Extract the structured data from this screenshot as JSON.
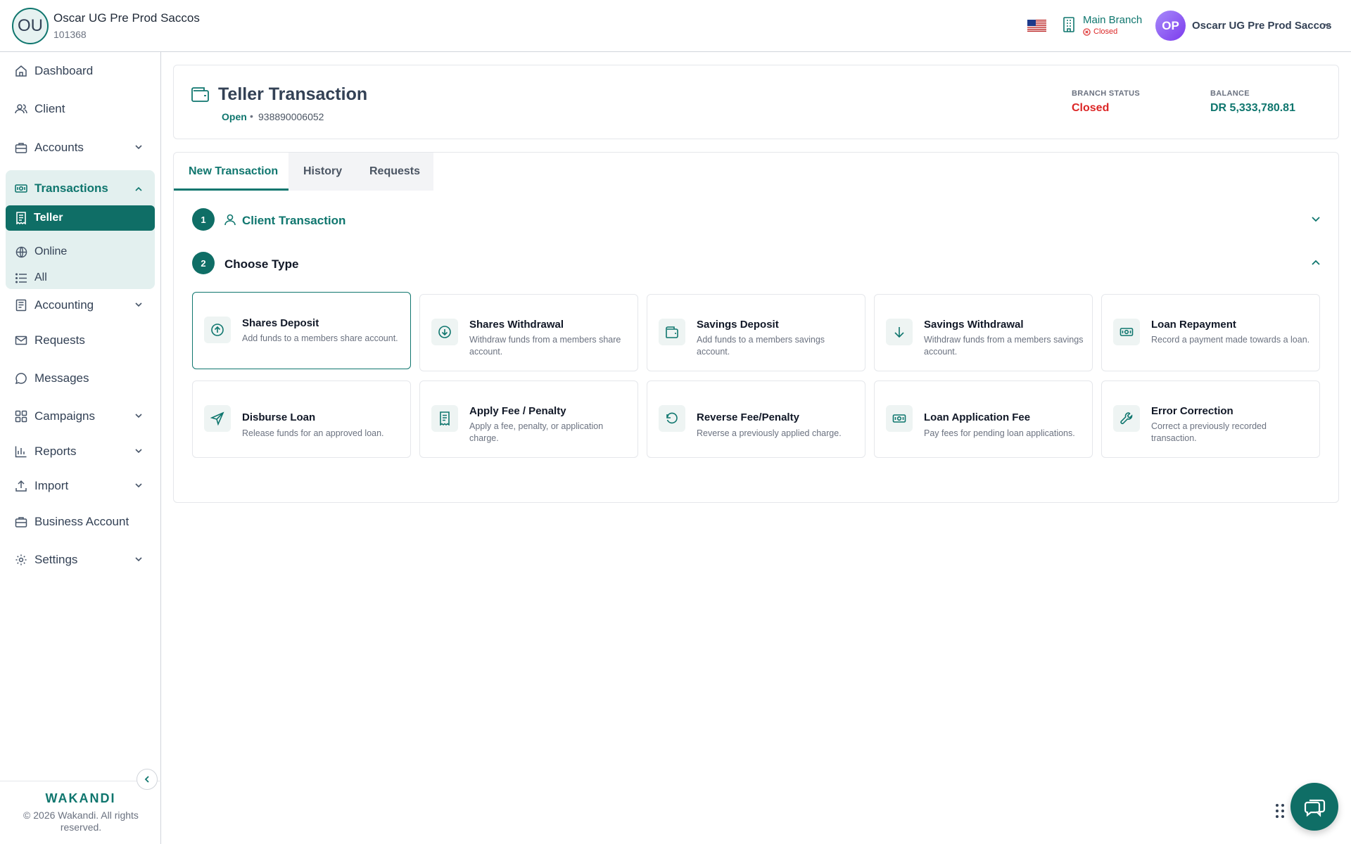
{
  "header": {
    "org_initials": "OU",
    "org_name": "Oscar UG Pre Prod Saccos",
    "org_id": "101368",
    "branch_name": "Main Branch",
    "branch_status": "Closed",
    "user_initials": "OP",
    "user_name": "Oscarr UG Pre Prod Saccos"
  },
  "sidebar": {
    "items": [
      {
        "label": "Dashboard",
        "icon": "home-icon"
      },
      {
        "label": "Client",
        "icon": "users-icon"
      },
      {
        "label": "Accounts",
        "icon": "briefcase-icon",
        "expandable": true
      },
      {
        "label": "Transactions",
        "icon": "banknote-icon",
        "expanded": true
      },
      {
        "label": "Accounting",
        "icon": "ledger-icon",
        "expandable": true
      },
      {
        "label": "Requests",
        "icon": "mail-icon"
      },
      {
        "label": "Messages",
        "icon": "chat-icon"
      },
      {
        "label": "Campaigns",
        "icon": "grid-icon",
        "expandable": true
      },
      {
        "label": "Reports",
        "icon": "bar-chart-icon",
        "expandable": true
      },
      {
        "label": "Import",
        "icon": "upload-icon",
        "expandable": true
      },
      {
        "label": "Business Account",
        "icon": "briefcase-icon"
      },
      {
        "label": "Settings",
        "icon": "gear-icon",
        "expandable": true
      }
    ],
    "transactions_sub": [
      {
        "label": "Teller",
        "icon": "receipt-icon",
        "active": true
      },
      {
        "label": "Online",
        "icon": "globe-icon"
      },
      {
        "label": "All",
        "icon": "list-icon"
      }
    ],
    "logo": "WAKANDI",
    "copyright": "© 2026 Wakandi. All rights reserved."
  },
  "title_card": {
    "title": "Teller Transaction",
    "till_state": "Open",
    "till_separator": "•",
    "till_number": "938890006052",
    "branch_status_label": "BRANCH STATUS",
    "branch_status_value": "Closed",
    "balance_label": "BALANCE",
    "balance_value": "DR 5,333,780.81"
  },
  "tabs": [
    {
      "label": "New Transaction",
      "active": true
    },
    {
      "label": "History"
    },
    {
      "label": "Requests"
    }
  ],
  "steps": [
    {
      "number": "1",
      "label": "Client Transaction",
      "expanded": false
    },
    {
      "number": "2",
      "label": "Choose Type",
      "expanded": true
    }
  ],
  "transaction_types": [
    {
      "title": "Shares Deposit",
      "desc": "Add funds to a members share account.",
      "icon": "arrow-up-circle-icon",
      "selected": true
    },
    {
      "title": "Shares Withdrawal",
      "desc": "Withdraw funds from a members share account.",
      "icon": "arrow-down-circle-icon"
    },
    {
      "title": "Savings Deposit",
      "desc": "Add funds to a members savings account.",
      "icon": "wallet-icon"
    },
    {
      "title": "Savings Withdrawal",
      "desc": "Withdraw funds from a members savings account.",
      "icon": "arrow-down-icon"
    },
    {
      "title": "Loan Repayment",
      "desc": "Record a payment made towards a loan.",
      "icon": "banknote-icon"
    },
    {
      "title": "Disburse Loan",
      "desc": "Release funds for an approved loan.",
      "icon": "send-icon"
    },
    {
      "title": "Apply Fee / Penalty",
      "desc": "Apply a fee, penalty, or application charge.",
      "icon": "receipt-icon"
    },
    {
      "title": "Reverse Fee/Penalty",
      "desc": "Reverse a previously applied charge.",
      "icon": "rotate-ccw-icon"
    },
    {
      "title": "Loan Application Fee",
      "desc": "Pay fees for pending loan applications.",
      "icon": "banknote-icon"
    },
    {
      "title": "Error Correction",
      "desc": "Correct a previously recorded transaction.",
      "icon": "wrench-icon"
    }
  ],
  "colors": {
    "accent": "#0f766e",
    "danger": "#dc2626",
    "sidebar_group_bg": "#e3f0ef"
  }
}
